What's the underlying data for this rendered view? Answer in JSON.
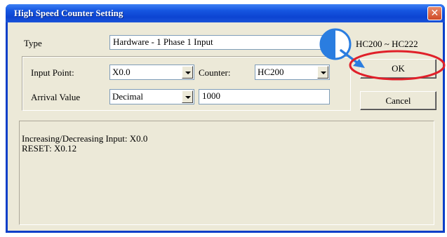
{
  "window": {
    "title": "High Speed Counter Setting",
    "close_glyph": "✕"
  },
  "type_row": {
    "label": "Type",
    "value": "Hardware - 1 Phase 1 Input",
    "range": "HC200 ~ HC222"
  },
  "input_point": {
    "label": "Input Point:",
    "value": "X0.0"
  },
  "counter": {
    "label": "Counter:",
    "value": "HC200"
  },
  "arrival": {
    "label": "Arrival Value",
    "format": "Decimal",
    "value": "1000"
  },
  "buttons": {
    "ok": "OK",
    "cancel": "Cancel"
  },
  "info": {
    "line1": "Increasing/Decreasing Input: X0.0",
    "line2": "RESET: X0.12"
  },
  "annotation": {
    "highlight_color": "#e0202a",
    "pointer_color": "#2a7de0"
  }
}
